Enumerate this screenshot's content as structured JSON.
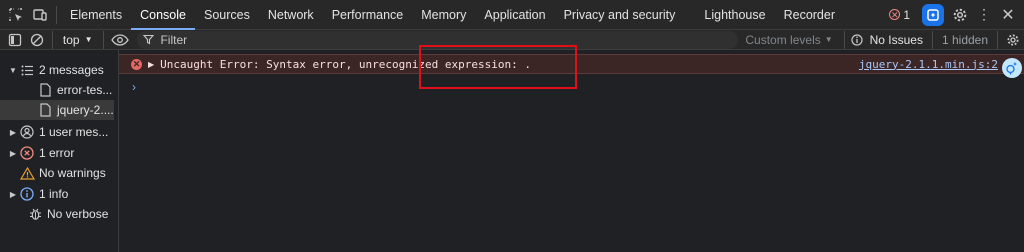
{
  "tabs": [
    "Elements",
    "Console",
    "Sources",
    "Network",
    "Performance",
    "Memory",
    "Application",
    "Privacy and security",
    "Lighthouse",
    "Recorder"
  ],
  "active_tab": "Console",
  "header": {
    "error_count": "1"
  },
  "toolbar": {
    "context": "top",
    "filter_placeholder": "Filter",
    "levels": "Custom levels",
    "issues": "No Issues",
    "hidden": "1 hidden"
  },
  "sidebar": {
    "messages": "2 messages",
    "file1": "error-tes...",
    "file2": "jquery-2....",
    "user_messages": "1 user mes...",
    "errors": "1 error",
    "warnings": "No warnings",
    "info": "1 info",
    "verbose": "No verbose"
  },
  "console": {
    "error_message": "Uncaught Error: Syntax error, unrecognized expression: .",
    "error_source": "jquery-2.1.1.min.js:2",
    "prompt": "›"
  },
  "colors": {
    "accent": "#7cacf8",
    "error": "#e46962",
    "annotation": "#e0101a"
  }
}
